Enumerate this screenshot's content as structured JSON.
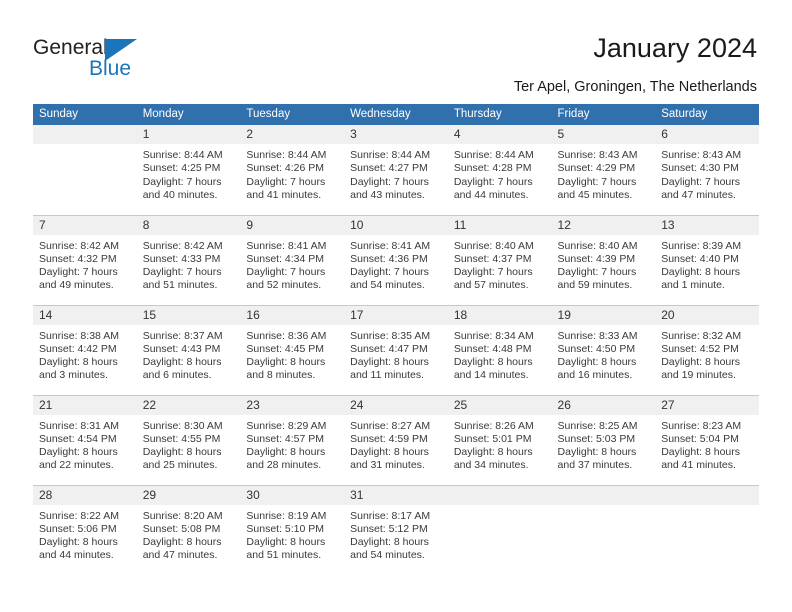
{
  "brand": {
    "name_part1": "General",
    "name_part2": "Blue",
    "logo_icon": "triangle-icon",
    "color_primary": "#1b75bb",
    "color_text": "#222222"
  },
  "header": {
    "title": "January 2024",
    "subtitle": "Ter Apel, Groningen, The Netherlands",
    "header_bg": "#3071ad",
    "header_text": "#ffffff"
  },
  "weekday_headers": [
    "Sunday",
    "Monday",
    "Tuesday",
    "Wednesday",
    "Thursday",
    "Friday",
    "Saturday"
  ],
  "weeks": [
    [
      {
        "day": "",
        "sunrise": "",
        "sunset": "",
        "daylight_1": "",
        "daylight_2": "",
        "empty": true
      },
      {
        "day": "1",
        "sunrise": "Sunrise: 8:44 AM",
        "sunset": "Sunset: 4:25 PM",
        "daylight_1": "Daylight: 7 hours",
        "daylight_2": "and 40 minutes."
      },
      {
        "day": "2",
        "sunrise": "Sunrise: 8:44 AM",
        "sunset": "Sunset: 4:26 PM",
        "daylight_1": "Daylight: 7 hours",
        "daylight_2": "and 41 minutes."
      },
      {
        "day": "3",
        "sunrise": "Sunrise: 8:44 AM",
        "sunset": "Sunset: 4:27 PM",
        "daylight_1": "Daylight: 7 hours",
        "daylight_2": "and 43 minutes."
      },
      {
        "day": "4",
        "sunrise": "Sunrise: 8:44 AM",
        "sunset": "Sunset: 4:28 PM",
        "daylight_1": "Daylight: 7 hours",
        "daylight_2": "and 44 minutes."
      },
      {
        "day": "5",
        "sunrise": "Sunrise: 8:43 AM",
        "sunset": "Sunset: 4:29 PM",
        "daylight_1": "Daylight: 7 hours",
        "daylight_2": "and 45 minutes."
      },
      {
        "day": "6",
        "sunrise": "Sunrise: 8:43 AM",
        "sunset": "Sunset: 4:30 PM",
        "daylight_1": "Daylight: 7 hours",
        "daylight_2": "and 47 minutes."
      }
    ],
    [
      {
        "day": "7",
        "sunrise": "Sunrise: 8:42 AM",
        "sunset": "Sunset: 4:32 PM",
        "daylight_1": "Daylight: 7 hours",
        "daylight_2": "and 49 minutes."
      },
      {
        "day": "8",
        "sunrise": "Sunrise: 8:42 AM",
        "sunset": "Sunset: 4:33 PM",
        "daylight_1": "Daylight: 7 hours",
        "daylight_2": "and 51 minutes."
      },
      {
        "day": "9",
        "sunrise": "Sunrise: 8:41 AM",
        "sunset": "Sunset: 4:34 PM",
        "daylight_1": "Daylight: 7 hours",
        "daylight_2": "and 52 minutes."
      },
      {
        "day": "10",
        "sunrise": "Sunrise: 8:41 AM",
        "sunset": "Sunset: 4:36 PM",
        "daylight_1": "Daylight: 7 hours",
        "daylight_2": "and 54 minutes."
      },
      {
        "day": "11",
        "sunrise": "Sunrise: 8:40 AM",
        "sunset": "Sunset: 4:37 PM",
        "daylight_1": "Daylight: 7 hours",
        "daylight_2": "and 57 minutes."
      },
      {
        "day": "12",
        "sunrise": "Sunrise: 8:40 AM",
        "sunset": "Sunset: 4:39 PM",
        "daylight_1": "Daylight: 7 hours",
        "daylight_2": "and 59 minutes."
      },
      {
        "day": "13",
        "sunrise": "Sunrise: 8:39 AM",
        "sunset": "Sunset: 4:40 PM",
        "daylight_1": "Daylight: 8 hours",
        "daylight_2": "and 1 minute."
      }
    ],
    [
      {
        "day": "14",
        "sunrise": "Sunrise: 8:38 AM",
        "sunset": "Sunset: 4:42 PM",
        "daylight_1": "Daylight: 8 hours",
        "daylight_2": "and 3 minutes."
      },
      {
        "day": "15",
        "sunrise": "Sunrise: 8:37 AM",
        "sunset": "Sunset: 4:43 PM",
        "daylight_1": "Daylight: 8 hours",
        "daylight_2": "and 6 minutes."
      },
      {
        "day": "16",
        "sunrise": "Sunrise: 8:36 AM",
        "sunset": "Sunset: 4:45 PM",
        "daylight_1": "Daylight: 8 hours",
        "daylight_2": "and 8 minutes."
      },
      {
        "day": "17",
        "sunrise": "Sunrise: 8:35 AM",
        "sunset": "Sunset: 4:47 PM",
        "daylight_1": "Daylight: 8 hours",
        "daylight_2": "and 11 minutes."
      },
      {
        "day": "18",
        "sunrise": "Sunrise: 8:34 AM",
        "sunset": "Sunset: 4:48 PM",
        "daylight_1": "Daylight: 8 hours",
        "daylight_2": "and 14 minutes."
      },
      {
        "day": "19",
        "sunrise": "Sunrise: 8:33 AM",
        "sunset": "Sunset: 4:50 PM",
        "daylight_1": "Daylight: 8 hours",
        "daylight_2": "and 16 minutes."
      },
      {
        "day": "20",
        "sunrise": "Sunrise: 8:32 AM",
        "sunset": "Sunset: 4:52 PM",
        "daylight_1": "Daylight: 8 hours",
        "daylight_2": "and 19 minutes."
      }
    ],
    [
      {
        "day": "21",
        "sunrise": "Sunrise: 8:31 AM",
        "sunset": "Sunset: 4:54 PM",
        "daylight_1": "Daylight: 8 hours",
        "daylight_2": "and 22 minutes."
      },
      {
        "day": "22",
        "sunrise": "Sunrise: 8:30 AM",
        "sunset": "Sunset: 4:55 PM",
        "daylight_1": "Daylight: 8 hours",
        "daylight_2": "and 25 minutes."
      },
      {
        "day": "23",
        "sunrise": "Sunrise: 8:29 AM",
        "sunset": "Sunset: 4:57 PM",
        "daylight_1": "Daylight: 8 hours",
        "daylight_2": "and 28 minutes."
      },
      {
        "day": "24",
        "sunrise": "Sunrise: 8:27 AM",
        "sunset": "Sunset: 4:59 PM",
        "daylight_1": "Daylight: 8 hours",
        "daylight_2": "and 31 minutes."
      },
      {
        "day": "25",
        "sunrise": "Sunrise: 8:26 AM",
        "sunset": "Sunset: 5:01 PM",
        "daylight_1": "Daylight: 8 hours",
        "daylight_2": "and 34 minutes."
      },
      {
        "day": "26",
        "sunrise": "Sunrise: 8:25 AM",
        "sunset": "Sunset: 5:03 PM",
        "daylight_1": "Daylight: 8 hours",
        "daylight_2": "and 37 minutes."
      },
      {
        "day": "27",
        "sunrise": "Sunrise: 8:23 AM",
        "sunset": "Sunset: 5:04 PM",
        "daylight_1": "Daylight: 8 hours",
        "daylight_2": "and 41 minutes."
      }
    ],
    [
      {
        "day": "28",
        "sunrise": "Sunrise: 8:22 AM",
        "sunset": "Sunset: 5:06 PM",
        "daylight_1": "Daylight: 8 hours",
        "daylight_2": "and 44 minutes."
      },
      {
        "day": "29",
        "sunrise": "Sunrise: 8:20 AM",
        "sunset": "Sunset: 5:08 PM",
        "daylight_1": "Daylight: 8 hours",
        "daylight_2": "and 47 minutes."
      },
      {
        "day": "30",
        "sunrise": "Sunrise: 8:19 AM",
        "sunset": "Sunset: 5:10 PM",
        "daylight_1": "Daylight: 8 hours",
        "daylight_2": "and 51 minutes."
      },
      {
        "day": "31",
        "sunrise": "Sunrise: 8:17 AM",
        "sunset": "Sunset: 5:12 PM",
        "daylight_1": "Daylight: 8 hours",
        "daylight_2": "and 54 minutes."
      },
      {
        "day": "",
        "sunrise": "",
        "sunset": "",
        "daylight_1": "",
        "daylight_2": "",
        "empty": true
      },
      {
        "day": "",
        "sunrise": "",
        "sunset": "",
        "daylight_1": "",
        "daylight_2": "",
        "empty": true
      },
      {
        "day": "",
        "sunrise": "",
        "sunset": "",
        "daylight_1": "",
        "daylight_2": "",
        "empty": true
      }
    ]
  ]
}
